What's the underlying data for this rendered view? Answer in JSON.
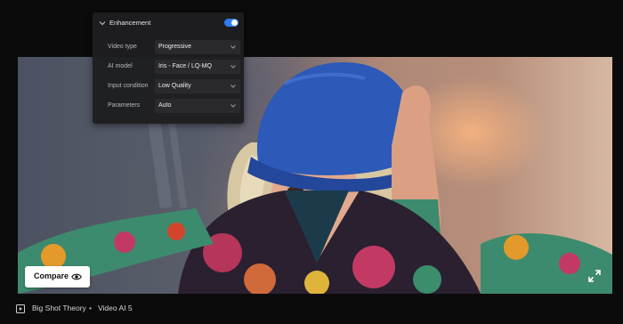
{
  "enhancement": {
    "title": "Enhancement",
    "enabled": true,
    "accent_color": "#2e7df6",
    "rows": [
      {
        "label": "Video type",
        "value": "Progressive"
      },
      {
        "label": "AI model",
        "value": "Iris - Face / LQ-MQ"
      },
      {
        "label": "Input condition",
        "value": "Low Quality"
      },
      {
        "label": "Parameters",
        "value": "Auto"
      }
    ]
  },
  "compare": {
    "label": "Compare",
    "icon": "eye-icon"
  },
  "expand_icon": "expand-icon",
  "breadcrumb": {
    "icon": "play-icon",
    "project": "Big Shot Theory",
    "separator": "•",
    "current": "Video AI 5"
  }
}
